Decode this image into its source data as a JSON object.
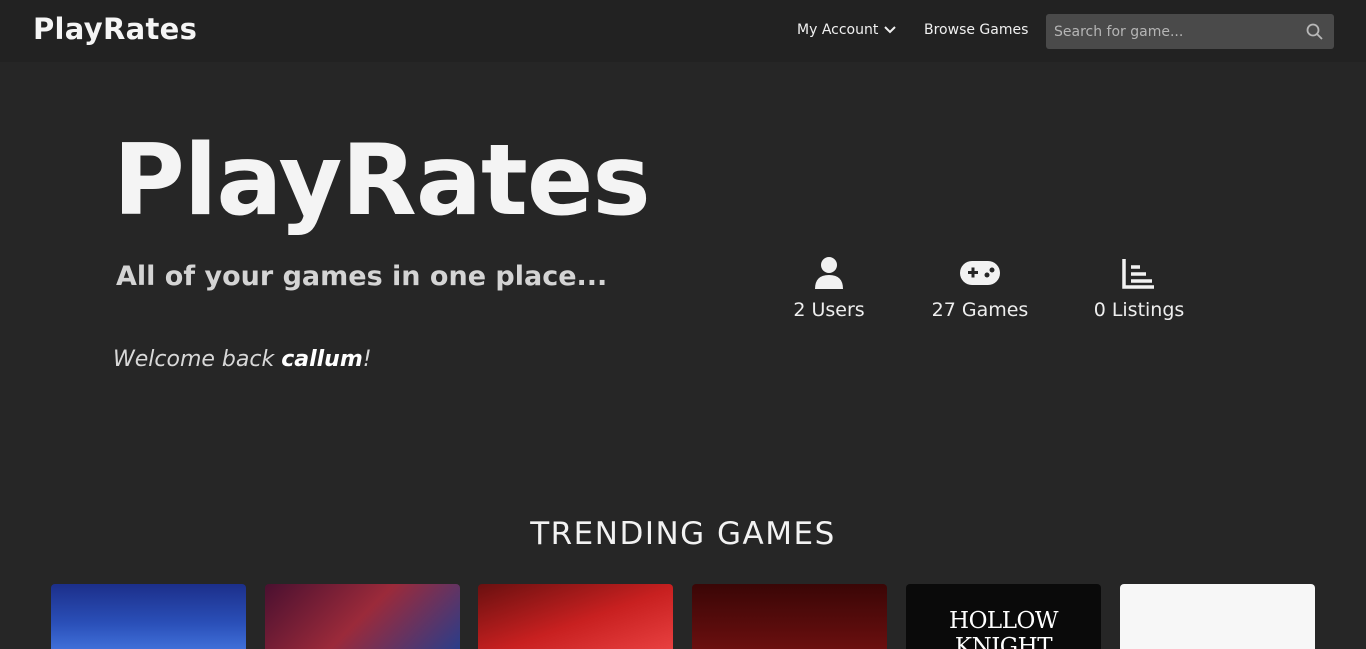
{
  "navbar": {
    "brand": "PlayRates",
    "account_label": "My Account",
    "browse_label": "Browse Games",
    "search_placeholder": "Search for game..."
  },
  "hero": {
    "title": "PlayRates",
    "subtitle": "All of your games in one place...",
    "welcome_prefix": "Welcome back ",
    "username": "callum",
    "welcome_suffix": "!"
  },
  "stats": [
    {
      "icon": "user-icon",
      "label": "2 Users"
    },
    {
      "icon": "gamepad-icon",
      "label": "27 Games"
    },
    {
      "icon": "chart-icon",
      "label": "0 Listings"
    }
  ],
  "trending": {
    "heading": "TRENDING GAMES",
    "games": [
      {
        "cover_text": ""
      },
      {
        "cover_text": ""
      },
      {
        "cover_text": ""
      },
      {
        "cover_text": ""
      },
      {
        "cover_text": "HOLLOW KNIGHT"
      },
      {
        "cover_text": ""
      }
    ]
  },
  "colors": {
    "background": "#262626",
    "navbar": "#222222",
    "search_field": "#4a4a4a"
  }
}
